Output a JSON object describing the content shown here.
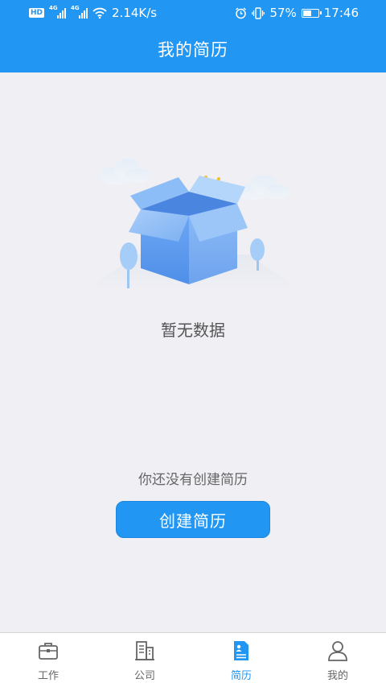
{
  "status_bar": {
    "hd": "HD",
    "net1": "4G",
    "net2": "4G",
    "speed": "2.14K/s",
    "battery_percent": "57%",
    "battery_level": 0.57,
    "time": "17:46"
  },
  "header": {
    "title": "我的简历"
  },
  "empty_state": {
    "title": "暂无数据",
    "hint": "你还没有创建简历",
    "button_label": "创建简历"
  },
  "bottom_nav": {
    "items": [
      {
        "label": "工作",
        "icon": "briefcase-icon",
        "active": false
      },
      {
        "label": "公司",
        "icon": "building-icon",
        "active": false
      },
      {
        "label": "简历",
        "icon": "resume-icon",
        "active": true
      },
      {
        "label": "我的",
        "icon": "user-icon",
        "active": false
      }
    ]
  },
  "colors": {
    "primary": "#2196f3",
    "background": "#efeff4",
    "inactive": "#666666"
  }
}
